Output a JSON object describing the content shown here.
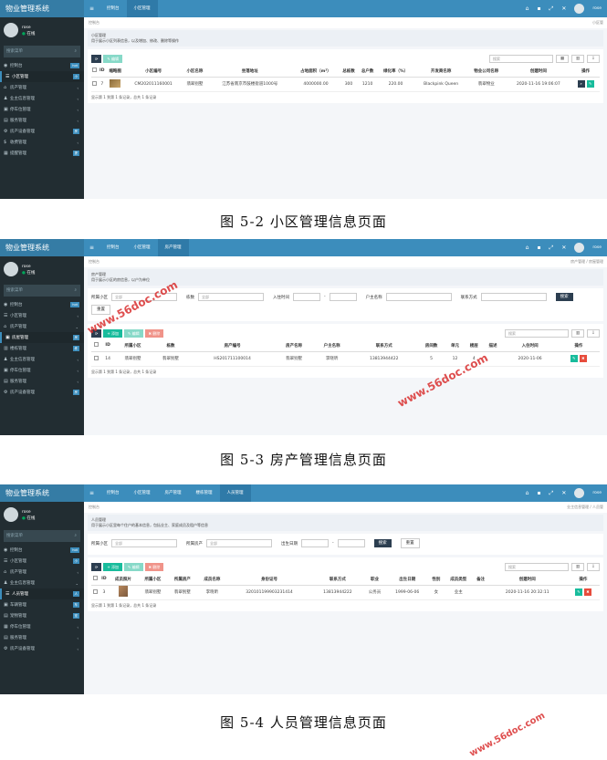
{
  "screenshot1": {
    "brand": "物业管理系统",
    "tabs": [
      "控制台",
      "小区管理"
    ],
    "user": "rose",
    "status": "在线",
    "search_placeholder": "搜索菜单",
    "menu": [
      {
        "label": "控制台",
        "badge": "hot"
      },
      {
        "label": "小区管理",
        "badge": "小"
      },
      {
        "label": "房产管理",
        "badge": ""
      },
      {
        "label": "业主信息管理",
        "badge": ""
      },
      {
        "label": "停车位管理",
        "badge": ""
      },
      {
        "label": "服务管理",
        "badge": ""
      },
      {
        "label": "房产设备管理",
        "badge": "房"
      },
      {
        "label": "收费管理",
        "badge": ""
      },
      {
        "label": "提醒管理",
        "badge": "提"
      }
    ],
    "crumb": "控制台",
    "crumb_right": "小区管",
    "page_title": "小区管理",
    "page_desc": "用于展示小区列表信息，以及增加、修改、删除等操作",
    "btn_edit": "编辑",
    "search_box": "搜索",
    "columns": [
      "ID",
      "缩略图",
      "小区编号",
      "小区名称",
      "坐落地址",
      "占地面积（m²）",
      "总栋数",
      "总户数",
      "绿化率（%）",
      "开发商名称",
      "物业公司名称",
      "创建时间",
      "操作"
    ],
    "rows": [
      [
        "7",
        "",
        "CM202011160001",
        "翡翠别墅",
        "江苏省南京市鼓楼街道1000号",
        "4000000.00",
        "300",
        "1210",
        "220.00",
        "Blackpink Queen",
        "翡翠物业",
        "2020-11-16 19:06:07"
      ]
    ],
    "footer": "显示第 1 到第 1 条记录，总共 1 条记录"
  },
  "caption1": "图 5-2 小区管理信息页面",
  "screenshot2": {
    "brand": "物业管理系统",
    "tabs": [
      "控制台",
      "小区管理",
      "房产管理"
    ],
    "user": "rose",
    "status": "在线",
    "search_placeholder": "搜索菜单",
    "menu": [
      {
        "label": "控制台",
        "badge": "hot"
      },
      {
        "label": "小区管理",
        "badge": ""
      },
      {
        "label": "房产管理",
        "badge": ""
      },
      {
        "label": "房屋管理",
        "badge": "房"
      },
      {
        "label": "楼栋管理",
        "badge": "栋"
      },
      {
        "label": "业主信息管理",
        "badge": ""
      },
      {
        "label": "停车位管理",
        "badge": ""
      },
      {
        "label": "服务管理",
        "badge": ""
      },
      {
        "label": "房产设备管理",
        "badge": "房"
      }
    ],
    "crumb": "控制台",
    "crumb_right": "房产管理 / 房屋管理",
    "page_title": "房产管理",
    "page_desc": "用于展示小区的房信息，以户为单位",
    "filters": [
      {
        "label": "所属小区",
        "value": "全部"
      },
      {
        "label": "栋数",
        "value": "全部"
      },
      {
        "label": "入住时间",
        "value": ""
      },
      {
        "label": "户主名称",
        "value": ""
      },
      {
        "label": "联系方式",
        "value": ""
      }
    ],
    "btn_search": "搜索",
    "btn_reset": "重置",
    "btn_add": "添加",
    "btn_edit": "编辑",
    "btn_delete": "删除",
    "search_box": "搜索",
    "columns": [
      "ID",
      "所属小区",
      "栋数",
      "房产编号",
      "房产名称",
      "户主名称",
      "联系方式",
      "房间数",
      "单元",
      "楼层",
      "描述",
      "入住时间",
      "操作"
    ],
    "rows": [
      [
        "14",
        "翡翠别墅",
        "翡翠别墅",
        "HS201711100014",
        "翡翠别墅",
        "李晓昕",
        "13813944422",
        "5",
        "12",
        "4",
        "",
        "2020-11-06"
      ]
    ],
    "footer": "显示第 1 到第 1 条记录，总共 1 条记录"
  },
  "caption2": "图 5-3 房产管理信息页面",
  "screenshot3": {
    "brand": "物业管理系统",
    "tabs": [
      "控制台",
      "小区管理",
      "房产管理",
      "楼栋管理",
      "人员管理"
    ],
    "user": "rose",
    "status": "在线",
    "search_placeholder": "搜索菜单",
    "menu": [
      {
        "label": "控制台",
        "badge": "hot"
      },
      {
        "label": "小区管理",
        "badge": "小"
      },
      {
        "label": "房产管理",
        "badge": ""
      },
      {
        "label": "业主信息管理",
        "badge": ""
      },
      {
        "label": "人员管理",
        "badge": "人"
      },
      {
        "label": "车辆管理",
        "badge": "车"
      },
      {
        "label": "宠物管理",
        "badge": "宠"
      },
      {
        "label": "停车位管理",
        "badge": ""
      },
      {
        "label": "服务管理",
        "badge": ""
      },
      {
        "label": "房产设备管理",
        "badge": ""
      }
    ],
    "crumb": "控制台",
    "crumb_right": "业主信息管理 / 人员管",
    "page_title": "人员管理",
    "page_desc": "用于展示小区里每个住户的基本信息，包括业主、家庭成员及租户等信息",
    "filters": [
      {
        "label": "所属小区",
        "value": "全部"
      },
      {
        "label": "所属房产",
        "value": "全部"
      },
      {
        "label": "出生日期",
        "value": ""
      }
    ],
    "btn_search": "搜索",
    "btn_reset": "重置",
    "btn_add": "添加",
    "btn_edit": "编辑",
    "btn_delete": "删除",
    "search_box": "搜索",
    "columns": [
      "ID",
      "成员照片",
      "所属小区",
      "所属房产",
      "成员名称",
      "身份证号",
      "联系方式",
      "职业",
      "出生日期",
      "性别",
      "成员类型",
      "备注",
      "创建时间",
      "操作"
    ],
    "rows": [
      [
        "3",
        "",
        "翡翠别墅",
        "翡翠别墅",
        "李晓昕",
        "320101199903231414",
        "13813944222",
        "公务员",
        "1999-06-06",
        "女",
        "业主",
        "",
        "2020-11-16 20:32:11"
      ]
    ],
    "footer": "显示第 1 到第 1 条记录，总共 1 条记录"
  },
  "caption3": "图 5-4 人员管理信息页面",
  "watermark": "www.56doc.com"
}
